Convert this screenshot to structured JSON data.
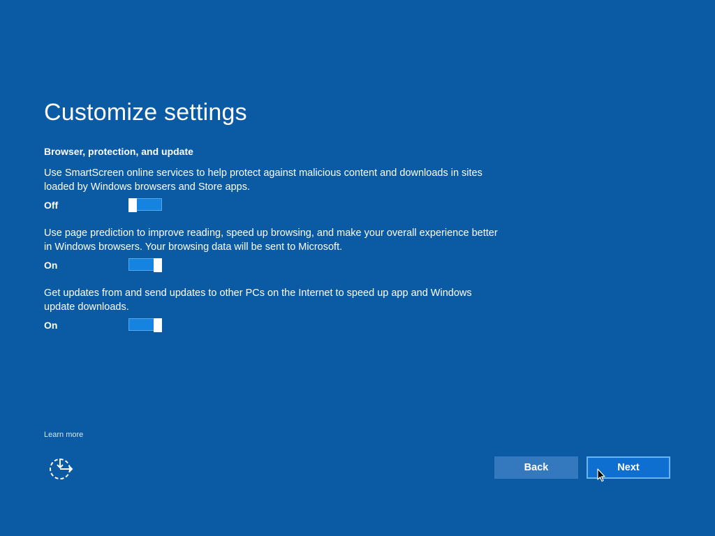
{
  "page": {
    "title": "Customize settings",
    "section_heading": "Browser, protection, and update"
  },
  "settings": [
    {
      "description": "Use SmartScreen online services to help protect against malicious content and downloads in sites loaded by Windows browsers and Store apps.",
      "state_label": "Off",
      "enabled": false
    },
    {
      "description": "Use page prediction to improve reading, speed up browsing, and make your overall experience better in Windows browsers. Your browsing data will be sent to Microsoft.",
      "state_label": "On",
      "enabled": true
    },
    {
      "description": "Get updates from and send updates to other PCs on the Internet to speed up app and Windows update downloads.",
      "state_label": "On",
      "enabled": true
    }
  ],
  "footer": {
    "learn_more": "Learn more",
    "ease_of_access_icon": "ease-of-access-icon",
    "back_label": "Back",
    "next_label": "Next"
  },
  "colors": {
    "background": "#0a5ba3",
    "toggle_track": "#1583e0",
    "back_button": "#3479bd",
    "next_button": "#0f6fd0"
  }
}
